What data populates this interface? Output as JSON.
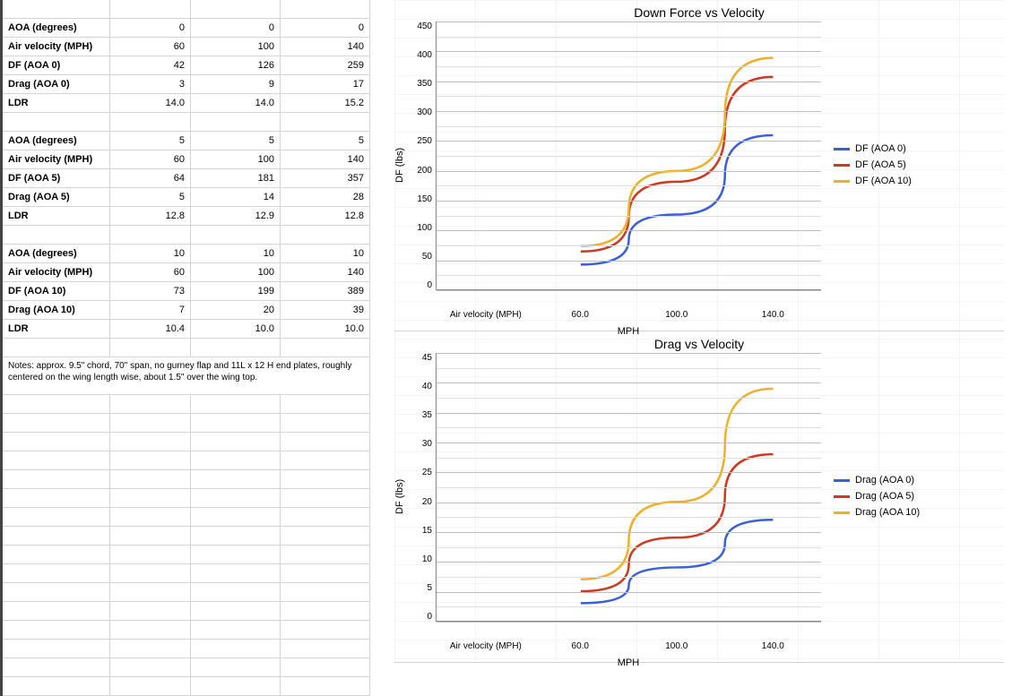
{
  "table": {
    "blocks": [
      {
        "rows": [
          {
            "label": "AOA (degrees)",
            "v": [
              "0",
              "0",
              "0"
            ]
          },
          {
            "label": "Air velocity (MPH)",
            "v": [
              "60",
              "100",
              "140"
            ]
          },
          {
            "label": "DF (AOA 0)",
            "v": [
              "42",
              "126",
              "259"
            ]
          },
          {
            "label": "Drag (AOA 0)",
            "v": [
              "3",
              "9",
              "17"
            ]
          },
          {
            "label": "LDR",
            "v": [
              "14.0",
              "14.0",
              "15.2"
            ]
          }
        ]
      },
      {
        "rows": [
          {
            "label": "AOA (degrees)",
            "v": [
              "5",
              "5",
              "5"
            ]
          },
          {
            "label": "Air velocity (MPH)",
            "v": [
              "60",
              "100",
              "140"
            ]
          },
          {
            "label": "DF (AOA 5)",
            "v": [
              "64",
              "181",
              "357"
            ]
          },
          {
            "label": "Drag (AOA 5)",
            "v": [
              "5",
              "14",
              "28"
            ]
          },
          {
            "label": "LDR",
            "v": [
              "12.8",
              "12.9",
              "12.8"
            ]
          }
        ]
      },
      {
        "rows": [
          {
            "label": "AOA (degrees)",
            "v": [
              "10",
              "10",
              "10"
            ]
          },
          {
            "label": "Air velocity (MPH)",
            "v": [
              "60",
              "100",
              "140"
            ]
          },
          {
            "label": "DF (AOA 10)",
            "v": [
              "73",
              "199",
              "389"
            ]
          },
          {
            "label": "Drag (AOA 10)",
            "v": [
              "7",
              "20",
              "39"
            ]
          },
          {
            "label": "LDR",
            "v": [
              "10.4",
              "10.0",
              "10.0"
            ]
          }
        ]
      }
    ],
    "notes": "Notes: approx. 9.5\" chord, 70\" span, no gurney flap and 11L x 12 H end plates, roughly centered on the wing length wise, about 1.5\" over the wing top."
  },
  "colors": {
    "series0": "#3a5fd6",
    "series1": "#cc3a23",
    "series2": "#eeb02b"
  },
  "chart_data": [
    {
      "type": "line",
      "title": "Down Force vs Velocity",
      "xlabel": "MPH",
      "ylabel": "DF (lbs)",
      "x_ticks": [
        "Air velocity (MPH)",
        "60.0",
        "100.0",
        "140.0"
      ],
      "categories": [
        60,
        100,
        140
      ],
      "ylim": [
        0,
        450
      ],
      "y_ticks": [
        450,
        400,
        350,
        300,
        250,
        200,
        150,
        100,
        50,
        0
      ],
      "series": [
        {
          "name": "DF (AOA 0)",
          "values": [
            42,
            126,
            259
          ]
        },
        {
          "name": "DF (AOA 5)",
          "values": [
            64,
            181,
            357
          ]
        },
        {
          "name": "DF (AOA 10)",
          "values": [
            73,
            199,
            389
          ]
        }
      ]
    },
    {
      "type": "line",
      "title": "Drag vs Velocity",
      "xlabel": "MPH",
      "ylabel": "DF (lbs)",
      "x_ticks": [
        "Air velocity (MPH)",
        "60.0",
        "100.0",
        "140.0"
      ],
      "categories": [
        60,
        100,
        140
      ],
      "ylim": [
        0,
        45
      ],
      "y_ticks": [
        45,
        40,
        35,
        30,
        25,
        20,
        15,
        10,
        5,
        0
      ],
      "series": [
        {
          "name": "Drag (AOA 0)",
          "values": [
            3,
            9,
            17
          ]
        },
        {
          "name": "Drag (AOA 5)",
          "values": [
            5,
            14,
            28
          ]
        },
        {
          "name": "Drag (AOA 10)",
          "values": [
            7,
            20,
            39
          ]
        }
      ]
    }
  ]
}
